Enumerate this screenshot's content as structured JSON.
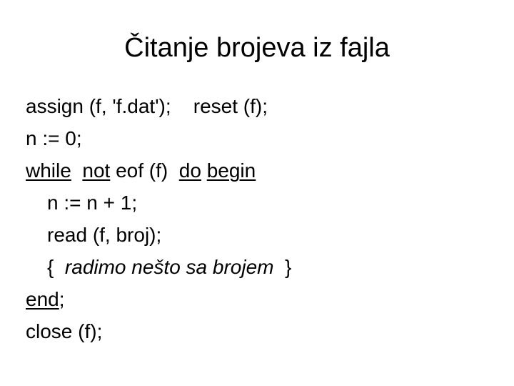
{
  "slide": {
    "title": "Čitanje brojeva iz fajla",
    "background_color": "#ffffff",
    "text_color": "#000000",
    "code": {
      "line1": {
        "statement": "assign (f, 'f.dat');",
        "gap": "    ",
        "statement2": "reset (f);"
      },
      "line2": {
        "text": "n := 0;"
      },
      "line3": {
        "kw_while": "while",
        "space1": "  ",
        "kw_not": "not",
        "plain1": " eof (f)  ",
        "kw_do": "do",
        "space2": " ",
        "kw_begin": "begin"
      },
      "line4": {
        "text": "n := n + 1;"
      },
      "line5": {
        "text": "read (f, broj);"
      },
      "line6": {
        "open_brace": "{ ",
        "comment": " radimo nešto sa brojem ",
        "close_brace": " }"
      },
      "line7": {
        "kw_end": "end",
        "semicolon": ";"
      },
      "line8": {
        "text": "close (f);"
      }
    }
  }
}
